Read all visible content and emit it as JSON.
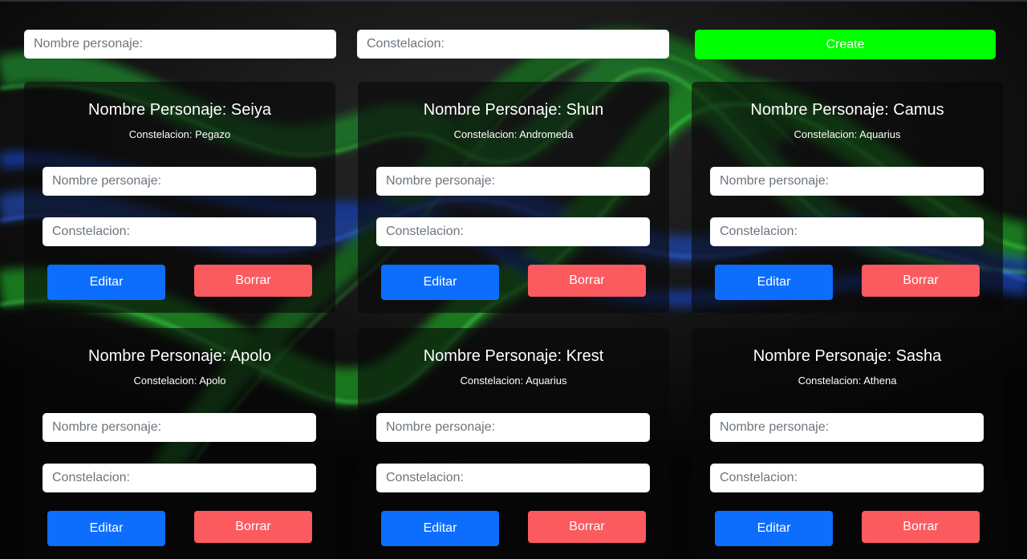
{
  "form": {
    "name_placeholder": "Nombre personaje:",
    "constellation_placeholder": "Constelacion:",
    "create_label": "Create"
  },
  "cards": [
    {
      "title": "Nombre Personaje: Seiya",
      "subtitle": "Constelacion: Pegazo",
      "name_placeholder": "Nombre personaje:",
      "constellation_placeholder": "Constelacion:",
      "edit_label": "Editar",
      "delete_label": "Borrar"
    },
    {
      "title": "Nombre Personaje: Shun",
      "subtitle": "Constelacion: Andromeda",
      "name_placeholder": "Nombre personaje:",
      "constellation_placeholder": "Constelacion:",
      "edit_label": "Editar",
      "delete_label": "Borrar"
    },
    {
      "title": "Nombre Personaje: Camus",
      "subtitle": "Constelacion: Aquarius",
      "name_placeholder": "Nombre personaje:",
      "constellation_placeholder": "Constelacion:",
      "edit_label": "Editar",
      "delete_label": "Borrar"
    },
    {
      "title": "Nombre Personaje: Apolo",
      "subtitle": "Constelacion: Apolo",
      "name_placeholder": "Nombre personaje:",
      "constellation_placeholder": "Constelacion:",
      "edit_label": "Editar",
      "delete_label": "Borrar"
    },
    {
      "title": "Nombre Personaje: Krest",
      "subtitle": "Constelacion: Aquarius",
      "name_placeholder": "Nombre personaje:",
      "constellation_placeholder": "Constelacion:",
      "edit_label": "Editar",
      "delete_label": "Borrar"
    },
    {
      "title": "Nombre Personaje: Sasha",
      "subtitle": "Constelacion: Athena",
      "name_placeholder": "Nombre personaje:",
      "constellation_placeholder": "Constelacion:",
      "edit_label": "Editar",
      "delete_label": "Borrar"
    }
  ],
  "colors": {
    "create": "#00ff00",
    "edit": "#0d6efd",
    "delete": "#fb5a5f",
    "background": "#050505"
  }
}
